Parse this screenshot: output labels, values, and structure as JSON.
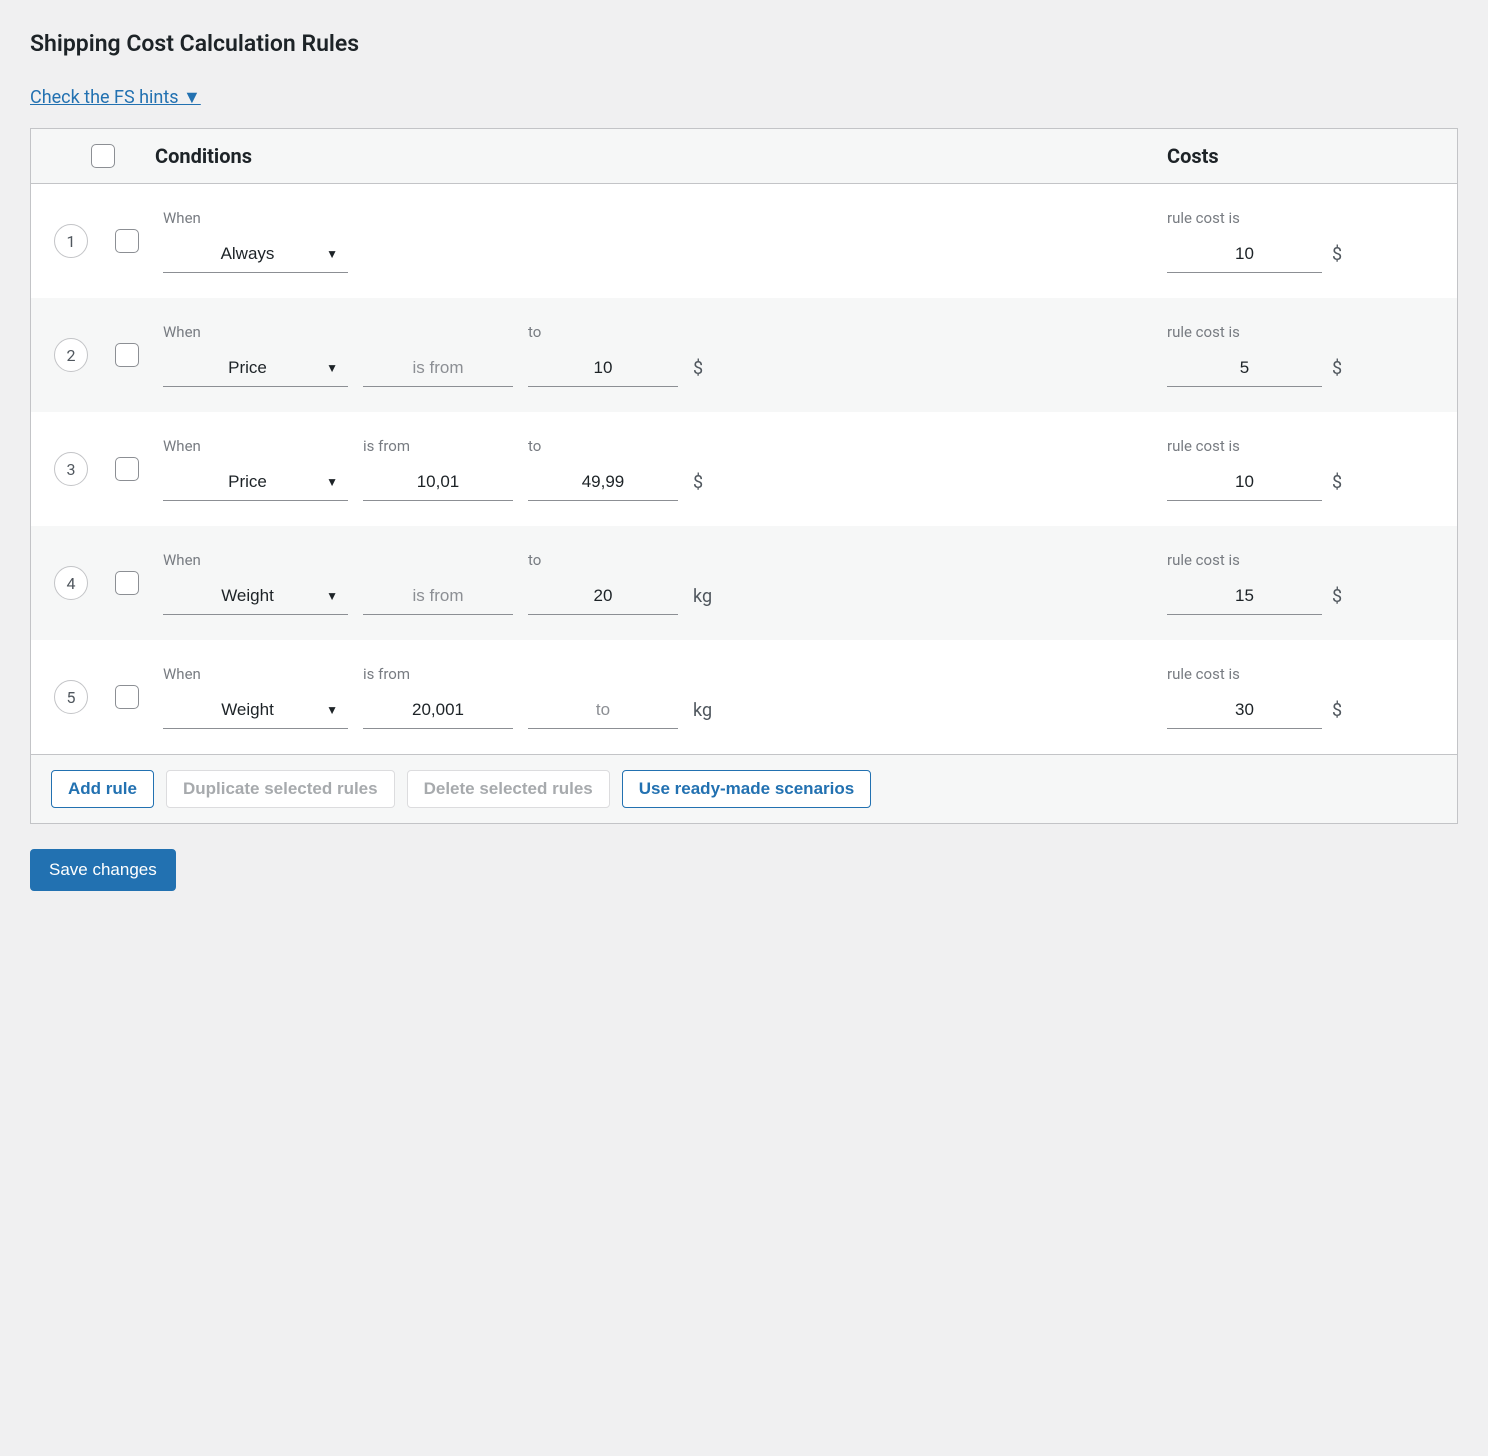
{
  "page_title": "Shipping Cost Calculation Rules",
  "hints_link": "Check the FS hints ▼",
  "headers": {
    "conditions": "Conditions",
    "costs": "Costs"
  },
  "labels": {
    "when": "When",
    "is_from": "is from",
    "to": "to",
    "rule_cost_is": "rule cost is",
    "is_from_placeholder": "is from",
    "to_placeholder": "to"
  },
  "units": {
    "currency": "$",
    "weight": "kg"
  },
  "rules": [
    {
      "number": "1",
      "condition_type": "Always",
      "from_label": "",
      "from_value": "",
      "to_label": "",
      "to_value": "",
      "unit": "",
      "cost": "10"
    },
    {
      "number": "2",
      "condition_type": "Price",
      "from_label": "",
      "from_value": "",
      "from_placeholder": "is from",
      "to_label": "to",
      "to_value": "10",
      "unit": "$",
      "cost": "5"
    },
    {
      "number": "3",
      "condition_type": "Price",
      "from_label": "is from",
      "from_value": "10,01",
      "to_label": "to",
      "to_value": "49,99",
      "unit": "$",
      "cost": "10"
    },
    {
      "number": "4",
      "condition_type": "Weight",
      "from_label": "",
      "from_value": "",
      "from_placeholder": "is from",
      "to_label": "to",
      "to_value": "20",
      "unit": "kg",
      "cost": "15"
    },
    {
      "number": "5",
      "condition_type": "Weight",
      "from_label": "is from",
      "from_value": "20,001",
      "to_label": "",
      "to_value": "",
      "to_placeholder": "to",
      "unit": "kg",
      "cost": "30"
    }
  ],
  "actions": {
    "add_rule": "Add rule",
    "duplicate": "Duplicate selected rules",
    "delete": "Delete selected rules",
    "scenarios": "Use ready-made scenarios"
  },
  "save_button": "Save changes"
}
